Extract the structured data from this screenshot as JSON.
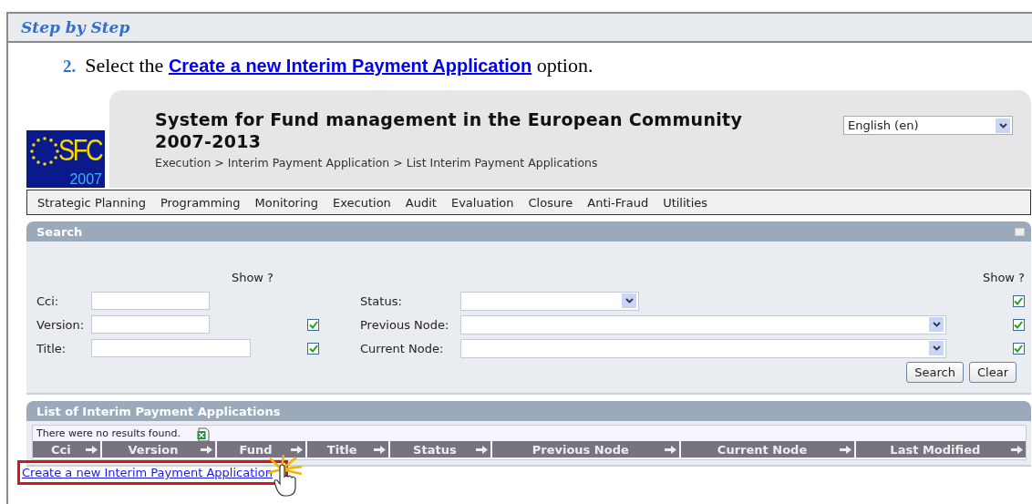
{
  "help_box": {
    "title": "Step by Step"
  },
  "step": {
    "number": "2.",
    "text_before": "Select the",
    "link": "Create a new Interim Payment Application",
    "text_after": "option."
  },
  "app": {
    "logo": {
      "text": "SFC",
      "year": "2007"
    },
    "title_lines": [
      "System for Fund management in the European Community",
      "2007-2013"
    ],
    "breadcrumb": "Execution > Interim Payment Application > List Interim Payment Applications",
    "language": "English (en)",
    "menu": [
      "Strategic Planning",
      "Programming",
      "Monitoring",
      "Execution",
      "Audit",
      "Evaluation",
      "Closure",
      "Anti-Fraud",
      "Utilities"
    ],
    "search": {
      "title": "Search",
      "show_header_left": "Show ?",
      "show_header_right": "Show ?",
      "left_fields": [
        {
          "label": "Cci:",
          "kind": "short"
        },
        {
          "label": "Version:",
          "kind": "short",
          "checked": true
        },
        {
          "label": "Title:",
          "kind": "long",
          "checked": true
        }
      ],
      "right_fields": [
        {
          "label": "Status:",
          "kind": "short",
          "checked": true
        },
        {
          "label": "Previous Node:",
          "kind": "long",
          "checked": true
        },
        {
          "label": "Current Node:",
          "kind": "long",
          "checked": true
        }
      ],
      "buttons": [
        "Search",
        "Clear"
      ]
    },
    "list": {
      "title": "List of Interim Payment Applications",
      "message": "There were no results found.",
      "columns": [
        "Cci",
        "Version",
        "Fund",
        "Title",
        "Status",
        "Previous Node",
        "Current Node",
        "Last Modified"
      ]
    },
    "create_link": "Create a new Interim Payment Application"
  }
}
